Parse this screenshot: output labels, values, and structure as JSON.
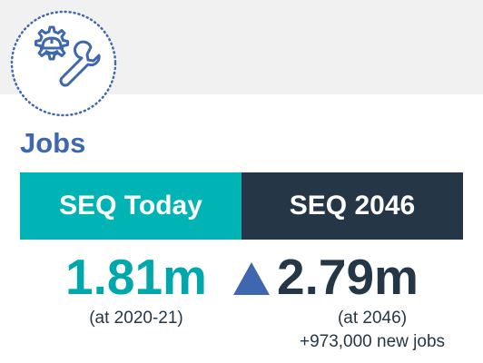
{
  "section": {
    "title": "Jobs",
    "icon": "gear-helmet-wrench-icon"
  },
  "columns": {
    "today": {
      "header": "SEQ Today",
      "value": "1.81m",
      "note": "(at 2020-21)"
    },
    "future": {
      "header": "SEQ 2046",
      "value": "2.79m",
      "note": "(at 2046)",
      "change": "+973,000 new jobs"
    }
  },
  "indicator": "up-arrow-icon",
  "colors": {
    "title": "#3e67b0",
    "today_header_bg": "#00b3b5",
    "today_value": "#00a7ab",
    "future_header_bg": "#253746",
    "arrow": "#3e67b0",
    "top_band": "#f1f1f2"
  }
}
